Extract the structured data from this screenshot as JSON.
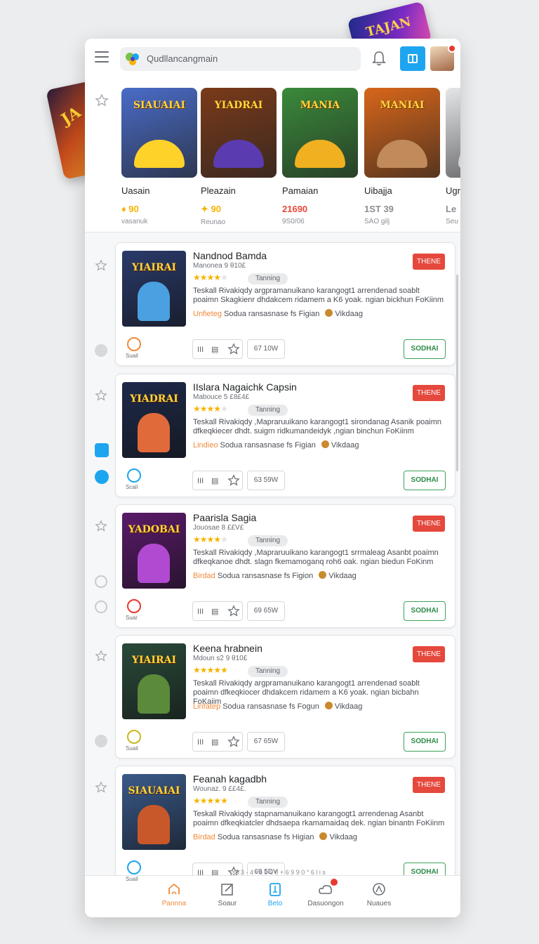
{
  "deco": {
    "left_text": "JA",
    "right_text": "TAJAN"
  },
  "search": {
    "value": "Qudllancangmain"
  },
  "carousel": [
    {
      "title": "Uasain",
      "price": "90",
      "price_prefix": "♦",
      "price_color": "#f5b400",
      "sub": "vasanuk",
      "art": "SIAUAIAI",
      "bg": "#4a6cc8",
      "blob": "#ffd22a"
    },
    {
      "title": "Pleazain",
      "price": "90",
      "price_prefix": "✦",
      "price_color": "#f5b400",
      "sub": "Reunao",
      "art": "YIADRAI",
      "bg": "#7a3a1a",
      "blob": "#5a3cb0"
    },
    {
      "title": "Pamaian",
      "price": "21690",
      "price_prefix": "",
      "price_color": "#e84a3a",
      "sub": "9S0/06",
      "art": "MANIA",
      "bg": "#3a8a3a",
      "blob": "#f0b020"
    },
    {
      "title": "Uibajja",
      "price": "1ST 39",
      "price_prefix": "",
      "price_color": "#8a8e94",
      "sub": "SAO gilj",
      "art": "MANIAI",
      "bg": "#d8661a",
      "blob": "#c08a5a"
    },
    {
      "title": "Ugr",
      "price": "Le",
      "price_prefix": "",
      "price_color": "#8a8e94",
      "sub": "Seu",
      "art": "",
      "bg": "#e6e7ea",
      "blob": "#d0d1d4"
    }
  ],
  "cards": [
    {
      "title": "Nandnod Bamda",
      "meta": "Manonea 9 θ10£",
      "rating": 4,
      "tag": "Tanning",
      "desc": "Teskall Rivakiqdy argpramanuikano karangogt1 arrendenad soablt poaimn Skagkienr dhdakcem ridamem a K6 yoak. ngian bickhun FoKiinm",
      "lang_hi": "Unfieteg",
      "lang": "Sodua ransasnase fs Figian",
      "studio": "Vikdaag",
      "badge": "THENE",
      "size": "67 10W",
      "action": "SODHAI",
      "side_label": "Suail",
      "side_color": "#f08a3a",
      "art": "YIAIRAI",
      "bg": "#2a3a6a",
      "blob": "#4aa0e0"
    },
    {
      "title": "IIslara Nagaichk Capsin",
      "meta": "Mabouce 5 £8£4£",
      "rating": 4,
      "tag": "Tanning",
      "desc": "Teskall Rivakiqdy ,Mapraruuikano karangogt1 sirondanag Asanik poaimn dfkeqkiecer dhdt. suigrn ridkumandeidyk ,ngian binchun FoKiinm",
      "lang_hi": "Lindieo",
      "lang": "Sodua ransasnase fs Figian",
      "studio": "Vikdaag",
      "badge": "THENE",
      "size": "63 59W",
      "action": "SODHAI",
      "side_label": "Scail",
      "side_color": "#1ea5ef",
      "art": "YIADRAI",
      "bg": "#1e2a4a",
      "blob": "#e06a3a"
    },
    {
      "title": "Paarisla Sagia",
      "meta": "Jouosae 8 ££V£",
      "rating": 4,
      "tag": "Tanning",
      "desc": "Teskall Rivakiqdy ,Mapraruuikano karangogt1 srrmaleag Asanbt poaimn dfkeqkanoe dhdt. slagn fkemamoganq roh6 oak. ngian biedun FoKinm",
      "lang_hi": "Birdad",
      "lang": "Sodua ransasnase fs Figion",
      "studio": "Vikdaag",
      "badge": "THENE",
      "size": "69 65W",
      "action": "SODHAI",
      "side_label": "Suar",
      "side_color": "#e63a2e",
      "art": "YADOBAI",
      "bg": "#5a1a6a",
      "blob": "#b04ad0"
    },
    {
      "title": "Keena hrabnein",
      "meta": "Mdoun s2 9 θ10£",
      "rating": 5,
      "tag": "Tanning",
      "desc": "Teskall Rivakiqdy argpramanuikano karangogt1 arrendenad soablt poaimn dfkeqkiocer dhdakcem ridamem a K6 yoak. ngian bicbahn FoKaiim",
      "lang_hi": "Linfatep",
      "lang": "Sodua ransasnase fs Fogun",
      "studio": "Vikdaag",
      "badge": "THENE",
      "size": "67 65W",
      "action": "SODHAI",
      "side_label": "Suail",
      "side_color": "#c8b820",
      "art": "YIAIRAI",
      "bg": "#2a4a3a",
      "blob": "#5a8a3a"
    },
    {
      "title": "Feanah kagadbh",
      "meta": "Wounaz. 9 ££4£.",
      "rating": 5,
      "tag": "Tanning",
      "desc": "Teskall Rivakiqdy stapnamanuikano karangogt1 arrendenag Asanbt poaimn dfkeqkiatcler dhdsaepa rkamamaidaq dek. ngian binantn FoKiinm",
      "lang_hi": "Birdad",
      "lang": "Sodua ransasnase fs Higian",
      "studio": "Vikdaag",
      "badge": "THENE",
      "size": "69 5DV",
      "action": "SODHAI",
      "side_label": "Suail",
      "side_color": "#1ea5ef",
      "art": "SIAUAIAI",
      "bg": "#3a5a8a",
      "blob": "#c8582a"
    }
  ],
  "peek_text": "s8 3 - 4 - 6 9 0 0 + 6 9 9 0 ° 6 l i s",
  "nav": [
    {
      "label": "Pannna",
      "icon": "home-icon",
      "state": "active"
    },
    {
      "label": "Soaur",
      "icon": "edit-icon",
      "state": ""
    },
    {
      "label": "Beto",
      "icon": "library-icon",
      "state": "sel"
    },
    {
      "label": "Dasuongon",
      "icon": "cloud-icon",
      "state": ""
    },
    {
      "label": "Nuaues",
      "icon": "compass-icon",
      "state": ""
    }
  ]
}
